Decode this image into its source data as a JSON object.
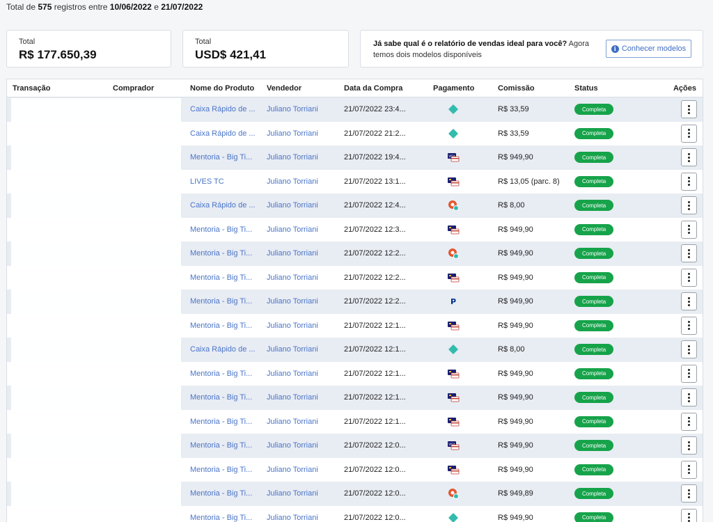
{
  "summary": {
    "prefix": "Total de",
    "count": "575",
    "middle": "registros entre",
    "start": "10/06/2022",
    "conj": "e",
    "end": "21/07/2022"
  },
  "cards": {
    "brl": {
      "label": "Total",
      "value": "R$ 177.650,39"
    },
    "usd": {
      "label": "Total",
      "value": "USD$ 421,41"
    },
    "promo": {
      "bold": "Já sabe qual é o relatório de vendas ideal para você?",
      "text": " Agora temos dois modelos disponíveis",
      "button": "Conhecer modelos",
      "button_icon": "info-icon"
    }
  },
  "table": {
    "headers": {
      "transacao": "Transação",
      "comprador": "Comprador",
      "produto": "Nome do Produto",
      "vendedor": "Vendedor",
      "data": "Data da Compra",
      "pagamento": "Pagamento",
      "comissao": "Comissão",
      "status": "Status",
      "acoes": "Ações"
    },
    "rows": [
      {
        "produto": "Caixa Rápido de ...",
        "vendedor": "Juliano Torriani",
        "data": "21/07/2022 23:4...",
        "pay": "pix",
        "comissao": "R$ 33,59",
        "status": "Completa"
      },
      {
        "produto": "Caixa Rápido de ...",
        "vendedor": "Juliano Torriani",
        "data": "21/07/2022 21:2...",
        "pay": "pix",
        "comissao": "R$ 33,59",
        "status": "Completa"
      },
      {
        "produto": "Mentoria - Big Ti...",
        "vendedor": "Juliano Torriani",
        "data": "21/07/2022 19:4...",
        "pay": "visa",
        "comissao": "R$ 949,90",
        "status": "Completa"
      },
      {
        "produto": "LIVES TC",
        "vendedor": "Juliano Torriani",
        "data": "21/07/2022 13:1...",
        "pay": "card",
        "comissao": "R$ 13,05 (parc. 8)",
        "status": "Completa"
      },
      {
        "produto": "Caixa Rápido de ...",
        "vendedor": "Juliano Torriani",
        "data": "21/07/2022 12:4...",
        "pay": "wallet",
        "comissao": "R$ 8,00",
        "status": "Completa"
      },
      {
        "produto": "Mentoria - Big Ti...",
        "vendedor": "Juliano Torriani",
        "data": "21/07/2022 12:3...",
        "pay": "card",
        "comissao": "R$ 949,90",
        "status": "Completa"
      },
      {
        "produto": "Mentoria - Big Ti...",
        "vendedor": "Juliano Torriani",
        "data": "21/07/2022 12:2...",
        "pay": "wallet",
        "comissao": "R$ 949,90",
        "status": "Completa"
      },
      {
        "produto": "Mentoria - Big Ti...",
        "vendedor": "Juliano Torriani",
        "data": "21/07/2022 12:2...",
        "pay": "card",
        "comissao": "R$ 949,90",
        "status": "Completa"
      },
      {
        "produto": "Mentoria - Big Ti...",
        "vendedor": "Juliano Torriani",
        "data": "21/07/2022 12:2...",
        "pay": "paypal",
        "comissao": "R$ 949,90",
        "status": "Completa"
      },
      {
        "produto": "Mentoria - Big Ti...",
        "vendedor": "Juliano Torriani",
        "data": "21/07/2022 12:1...",
        "pay": "card",
        "comissao": "R$ 949,90",
        "status": "Completa"
      },
      {
        "produto": "Caixa Rápido de ...",
        "vendedor": "Juliano Torriani",
        "data": "21/07/2022 12:1...",
        "pay": "pix",
        "comissao": "R$ 8,00",
        "status": "Completa"
      },
      {
        "produto": "Mentoria - Big Ti...",
        "vendedor": "Juliano Torriani",
        "data": "21/07/2022 12:1...",
        "pay": "card",
        "comissao": "R$ 949,90",
        "status": "Completa"
      },
      {
        "produto": "Mentoria - Big Ti...",
        "vendedor": "Juliano Torriani",
        "data": "21/07/2022 12:1...",
        "pay": "card",
        "comissao": "R$ 949,90",
        "status": "Completa"
      },
      {
        "produto": "Mentoria - Big Ti...",
        "vendedor": "Juliano Torriani",
        "data": "21/07/2022 12:1...",
        "pay": "card",
        "comissao": "R$ 949,90",
        "status": "Completa"
      },
      {
        "produto": "Mentoria - Big Ti...",
        "vendedor": "Juliano Torriani",
        "data": "21/07/2022 12:0...",
        "pay": "visa",
        "comissao": "R$ 949,90",
        "status": "Completa"
      },
      {
        "produto": "Mentoria - Big Ti...",
        "vendedor": "Juliano Torriani",
        "data": "21/07/2022 12:0...",
        "pay": "card",
        "comissao": "R$ 949,90",
        "status": "Completa"
      },
      {
        "produto": "Mentoria - Big Ti...",
        "vendedor": "Juliano Torriani",
        "data": "21/07/2022 12:0...",
        "pay": "wallet",
        "comissao": "R$ 949,89",
        "status": "Completa"
      },
      {
        "produto": "Mentoria - Big Ti...",
        "vendedor": "Juliano Torriani",
        "data": "21/07/2022 12:0...",
        "pay": "pix",
        "comissao": "R$ 949,90",
        "status": "Completa"
      }
    ]
  },
  "colors": {
    "link": "#4a75c8",
    "status": "#16a34a",
    "row_alt": "#e8ecf3"
  }
}
